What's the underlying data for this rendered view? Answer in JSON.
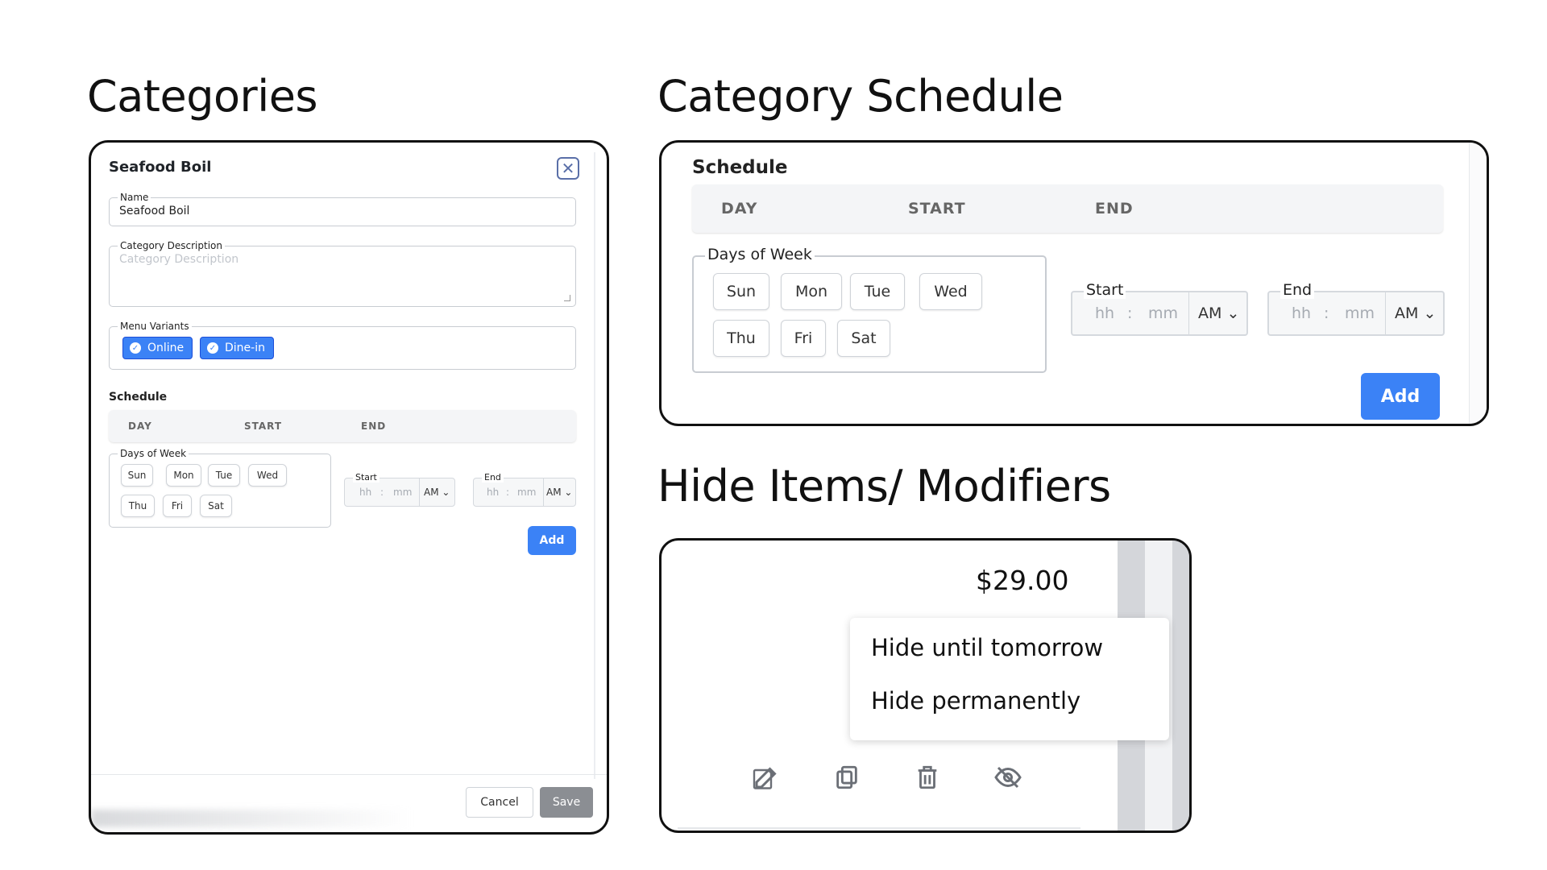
{
  "sections": {
    "categories_title": "Categories",
    "schedule_title": "Category Schedule",
    "hide_title": "Hide Items/ Modifiers"
  },
  "modal": {
    "title": "Seafood Boil",
    "name_label": "Name",
    "name_value": "Seafood Boil",
    "description_label": "Category Description",
    "description_placeholder": "Category Description",
    "variants_label": "Menu Variants",
    "variants": [
      "Online",
      "Dine-in"
    ],
    "schedule_title": "Schedule",
    "schedule_headers": [
      "DAY",
      "START",
      "END"
    ],
    "days_label": "Days of Week",
    "days": [
      "Sun",
      "Mon",
      "Tue",
      "Wed",
      "Thu",
      "Fri",
      "Sat"
    ],
    "start_label": "Start",
    "end_label": "End",
    "hh": "hh",
    "colon": ":",
    "mm": "mm",
    "ampm": "AM",
    "add_label": "Add",
    "cancel_label": "Cancel",
    "save_label": "Save"
  },
  "schedule": {
    "title": "Schedule",
    "headers": [
      "DAY",
      "START",
      "END"
    ],
    "days_label": "Days of Week",
    "days": [
      "Sun",
      "Mon",
      "Tue",
      "Wed",
      "Thu",
      "Fri",
      "Sat"
    ],
    "start_label": "Start",
    "end_label": "End",
    "hh": "hh",
    "colon": ":",
    "mm": "mm",
    "ampm": "AM",
    "add_label": "Add"
  },
  "hide": {
    "price": "$29.00",
    "menu": [
      "Hide until tomorrow",
      "Hide permanently"
    ],
    "actions": [
      "edit-icon",
      "copy-icon",
      "trash-icon",
      "eye-off-icon"
    ]
  },
  "colors": {
    "accent": "#3b82f6",
    "save_disabled": "#8b8e93"
  }
}
